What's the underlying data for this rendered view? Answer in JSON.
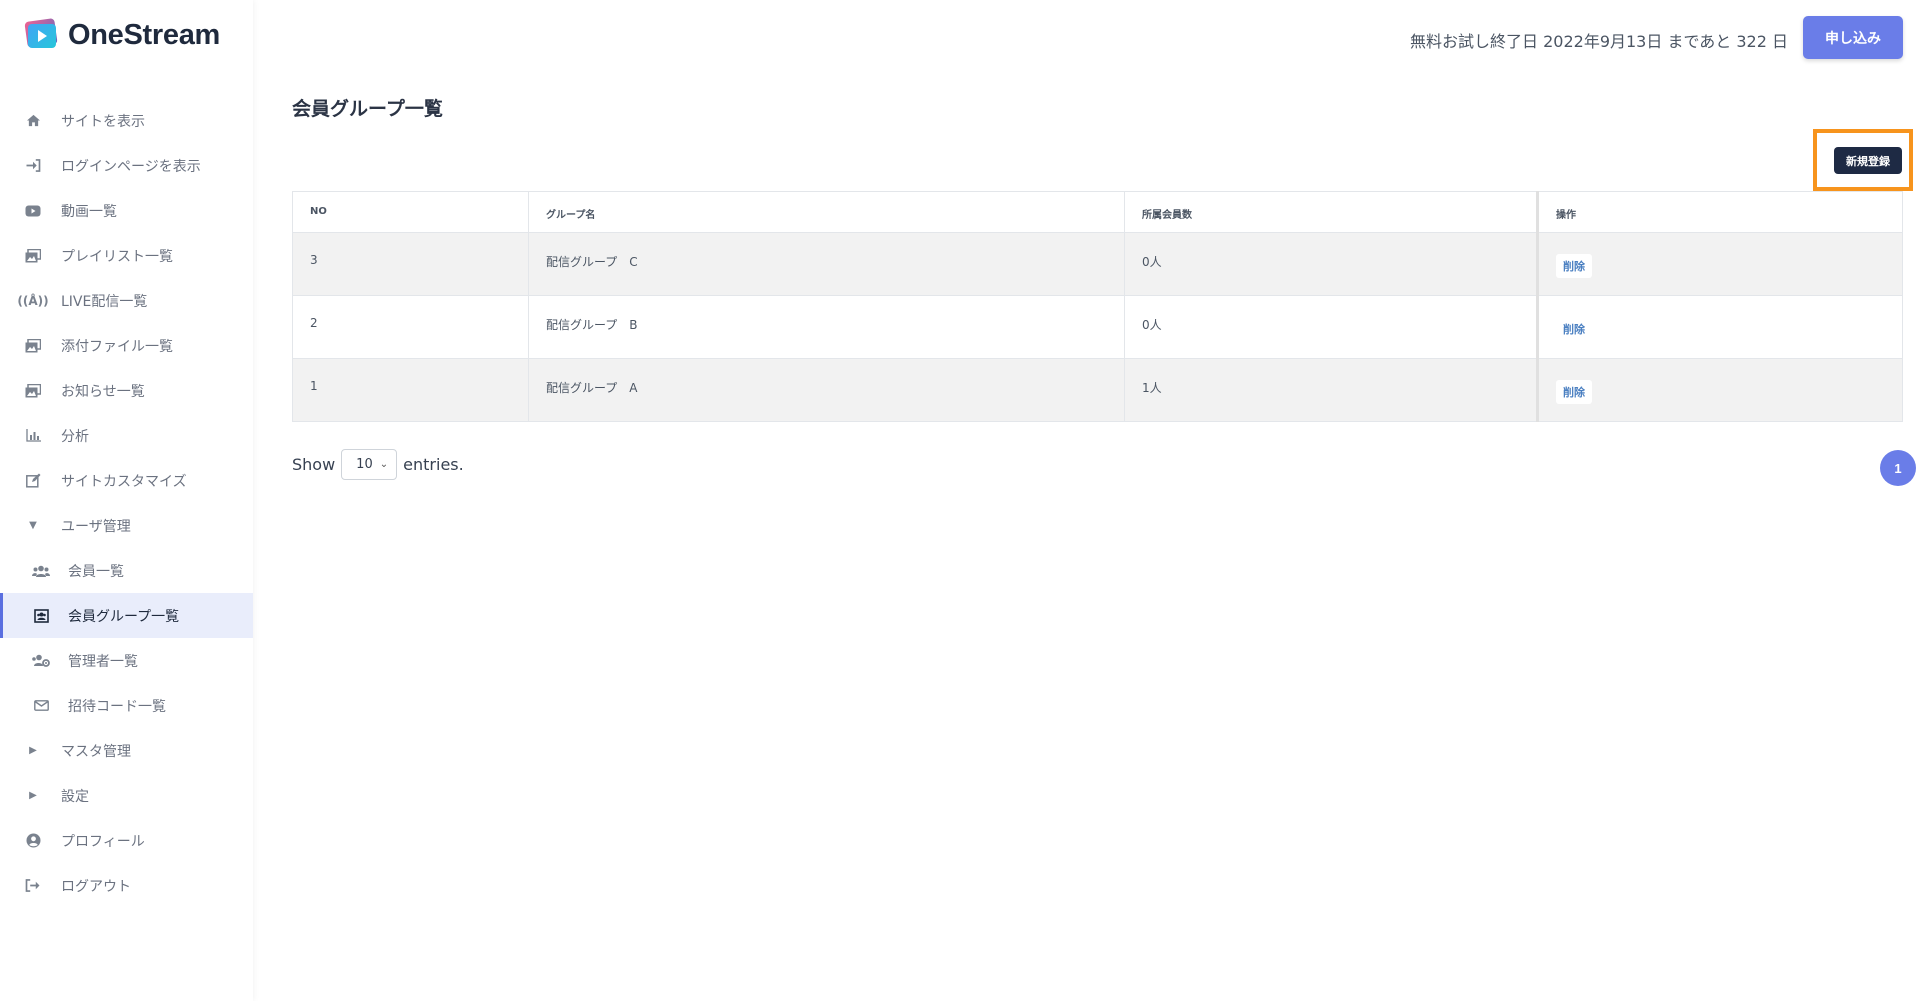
{
  "brand": {
    "name": "OneStream"
  },
  "header": {
    "trial_text": "無料お試し終了日 2022年9月13日 まであと 322 日",
    "apply_label": "申し込み"
  },
  "sidebar": {
    "items": [
      {
        "label": "サイトを表示",
        "icon": "home-icon"
      },
      {
        "label": "ログインページを表示",
        "icon": "sign-in-icon"
      },
      {
        "label": "動画一覧",
        "icon": "youtube-icon"
      },
      {
        "label": "プレイリスト一覧",
        "icon": "images-icon"
      },
      {
        "label": "LIVE配信一覧",
        "icon": "broadcast-icon"
      },
      {
        "label": "添付ファイル一覧",
        "icon": "images-icon"
      },
      {
        "label": "お知らせ一覧",
        "icon": "images-icon"
      },
      {
        "label": "分析",
        "icon": "bar-chart-icon"
      },
      {
        "label": "サイトカスタマイズ",
        "icon": "edit-icon"
      },
      {
        "label": "ユーザ管理",
        "icon": "caret-down-icon"
      },
      {
        "label": "会員一覧",
        "icon": "users-icon"
      },
      {
        "label": "会員グループ一覧",
        "icon": "group-icon"
      },
      {
        "label": "管理者一覧",
        "icon": "users-cog-icon"
      },
      {
        "label": "招待コード一覧",
        "icon": "envelope-icon"
      },
      {
        "label": "マスタ管理",
        "icon": "caret-right-icon"
      },
      {
        "label": "設定",
        "icon": "caret-right-icon"
      },
      {
        "label": "プロフィール",
        "icon": "user-circle-icon"
      },
      {
        "label": "ログアウト",
        "icon": "sign-out-icon"
      }
    ]
  },
  "main": {
    "title": "会員グループ一覧",
    "new_button_label": "新規登録",
    "table": {
      "headers": [
        "NO",
        "グループ名",
        "所属会員数",
        "操作"
      ],
      "rows": [
        {
          "no": "3",
          "name": "配信グループ　C",
          "count": "0人",
          "action": "削除"
        },
        {
          "no": "2",
          "name": "配信グループ　B",
          "count": "0人",
          "action": "削除"
        },
        {
          "no": "1",
          "name": "配信グループ　A",
          "count": "1人",
          "action": "削除"
        }
      ]
    },
    "show_label": "Show",
    "entries_value": "10",
    "entries_label": "entries.",
    "current_page": "1"
  },
  "colors": {
    "accent": "#6a7de8",
    "highlight": "#f7941d",
    "dark_button": "#1e2a44"
  }
}
